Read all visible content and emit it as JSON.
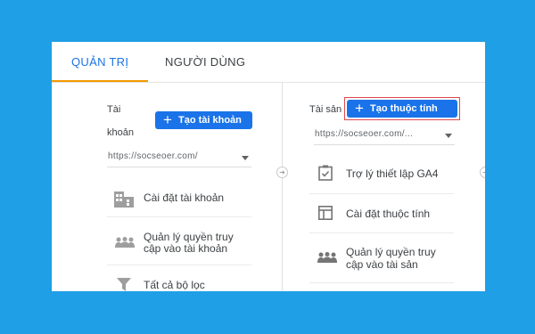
{
  "tabs": [
    {
      "label": "QUẢN TRỊ",
      "active": true
    },
    {
      "label": "NGƯỜI DÙNG",
      "active": false
    }
  ],
  "account": {
    "label_line1": "Tài",
    "label_line2": "khoản",
    "create_button": "Tạo tài khoản",
    "selector_value": "https://socseoer.com/",
    "items": [
      {
        "icon": "building-icon",
        "label": "Cài đặt tài khoản"
      },
      {
        "icon": "people-icon",
        "label_line1": "Quản lý quyền truy",
        "label_line2": "cập vào tài khoản"
      },
      {
        "icon": "filter-icon",
        "label": "Tất cả bộ lọc"
      }
    ]
  },
  "property": {
    "label": "Tài sản",
    "create_button": "Tạo thuộc tính",
    "selector_value": "https://socseoer.com/...",
    "items": [
      {
        "icon": "checklist-icon",
        "label": "Trợ lý thiết lập GA4"
      },
      {
        "icon": "layout-icon",
        "label": "Cài đặt thuộc tính"
      },
      {
        "icon": "people-icon",
        "label_line1": "Quản lý quyền truy",
        "label_line2": "cập vào tài sản"
      }
    ]
  },
  "colors": {
    "background": "#1e9fe6",
    "accent": "#1a73e8",
    "active_tab_underline": "#f29900",
    "highlight_border": "#e0474c"
  }
}
